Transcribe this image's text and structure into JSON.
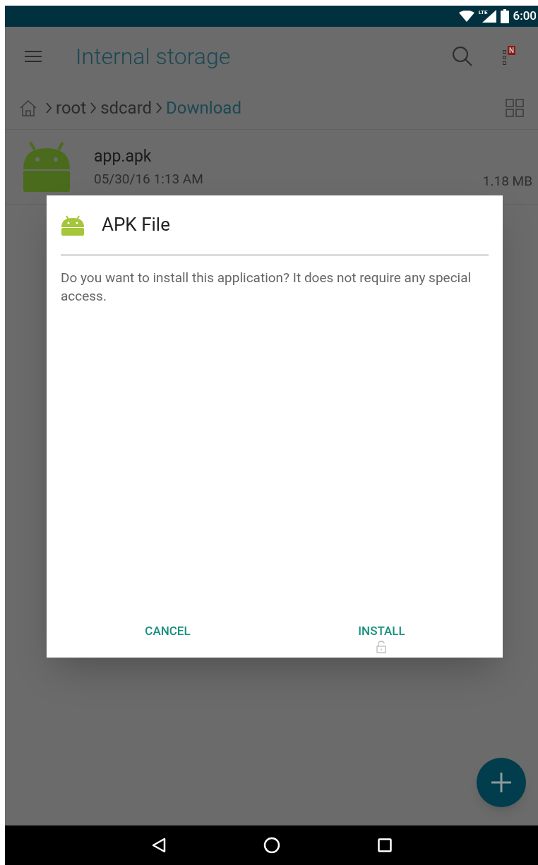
{
  "status_bar": {
    "network": "LTE",
    "time": "6:00"
  },
  "app_bar": {
    "title": "Internal storage",
    "notification_badge": "N"
  },
  "breadcrumb": [
    "root",
    "sdcard",
    "Download"
  ],
  "files": [
    {
      "name": "app.apk",
      "date": "05/30/16 1:13 AM",
      "size": "1.18 MB"
    }
  ],
  "dialog": {
    "title": "APK File",
    "message": "Do you want to install this application? It does not require any special access.",
    "buttons": [
      {
        "label": "CANCEL",
        "locked": false
      },
      {
        "label": "INSTALL",
        "locked": true
      }
    ]
  }
}
